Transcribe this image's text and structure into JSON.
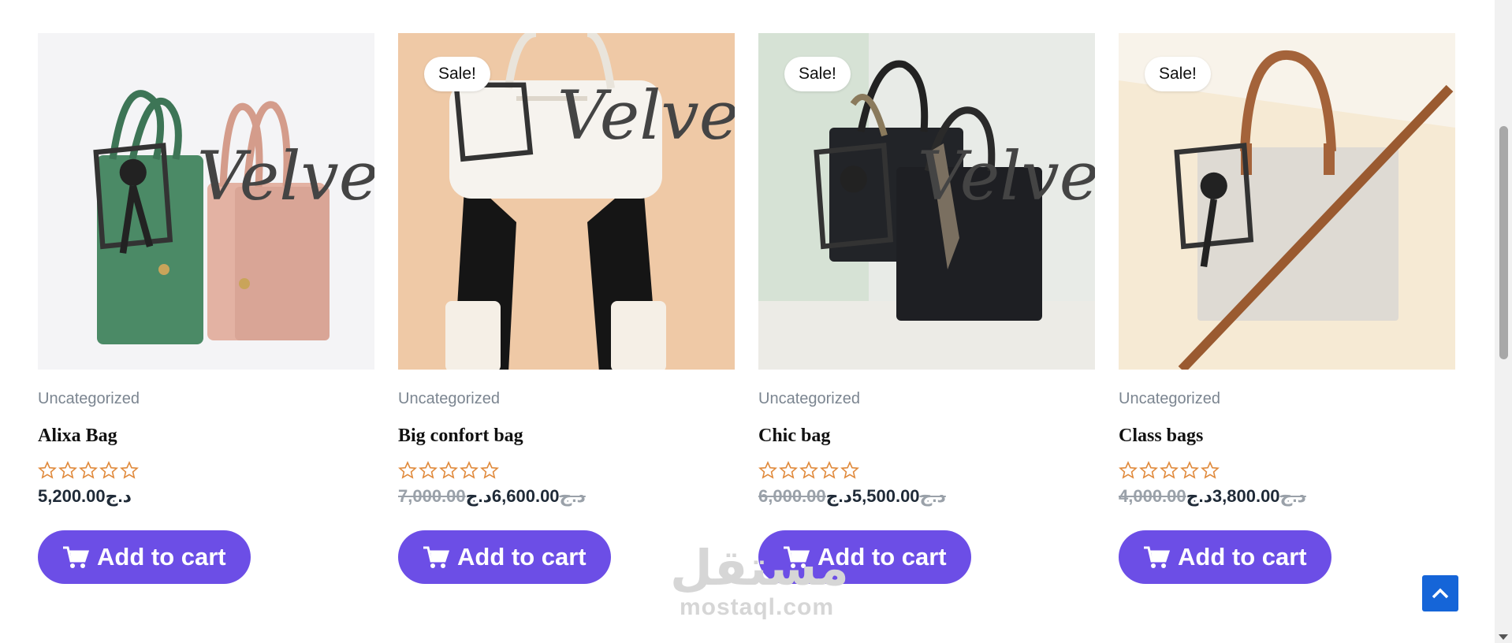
{
  "products": [
    {
      "category": "Uncategorized",
      "name": "Alixa Bag",
      "sale": "",
      "old_price": "",
      "price": "5,200.00د.ج",
      "rating": 0,
      "cart_label": "Add to cart"
    },
    {
      "category": "Uncategorized",
      "name": "Big confort bag",
      "sale": "Sale!",
      "old_price": "7,000.00د.ج",
      "price": "6,600.00د.ج",
      "rating": 0,
      "cart_label": "Add to cart"
    },
    {
      "category": "Uncategorized",
      "name": "Chic bag",
      "sale": "Sale!",
      "old_price": "6,000.00د.ج",
      "price": "5,500.00د.ج",
      "rating": 0,
      "cart_label": "Add to cart"
    },
    {
      "category": "Uncategorized",
      "name": "Class bags",
      "sale": "Sale!",
      "old_price": "4,000.00د.ج",
      "price": "3,800.00د.ج",
      "rating": 0,
      "cart_label": "Add to cart"
    }
  ],
  "watermark": {
    "arabic": "مستقل",
    "latin": "mostaql.com"
  },
  "colors": {
    "accent": "#6c4ee6",
    "star": "#e08a3c",
    "top_button": "#1565d8"
  },
  "icons": {
    "cart": "cart-icon",
    "star": "star-outline-icon",
    "top": "chevron-up-icon"
  }
}
